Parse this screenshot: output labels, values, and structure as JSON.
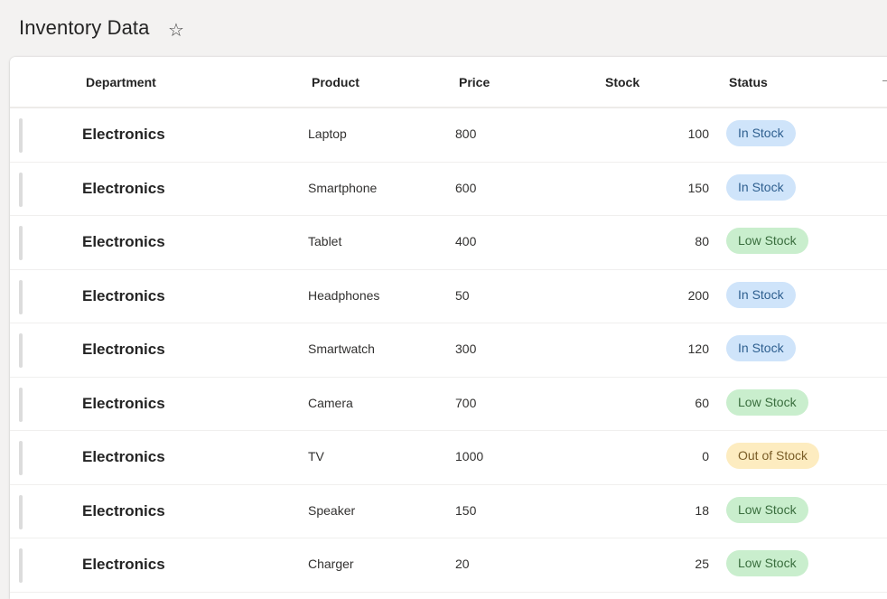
{
  "page": {
    "title": "Inventory Data",
    "star_icon": "star-outline-icon"
  },
  "table": {
    "columns": {
      "department": "Department",
      "product": "Product",
      "price": "Price",
      "stock": "Stock",
      "status": "Status"
    },
    "rows": [
      {
        "department": "Electronics",
        "product": "Laptop",
        "price": "800",
        "stock": "100",
        "status": "In Stock",
        "status_kind": "in"
      },
      {
        "department": "Electronics",
        "product": "Smartphone",
        "price": "600",
        "stock": "150",
        "status": "In Stock",
        "status_kind": "in"
      },
      {
        "department": "Electronics",
        "product": "Tablet",
        "price": "400",
        "stock": "80",
        "status": "Low Stock",
        "status_kind": "low"
      },
      {
        "department": "Electronics",
        "product": "Headphones",
        "price": "50",
        "stock": "200",
        "status": "In Stock",
        "status_kind": "in"
      },
      {
        "department": "Electronics",
        "product": "Smartwatch",
        "price": "300",
        "stock": "120",
        "status": "In Stock",
        "status_kind": "in"
      },
      {
        "department": "Electronics",
        "product": "Camera",
        "price": "700",
        "stock": "60",
        "status": "Low Stock",
        "status_kind": "low"
      },
      {
        "department": "Electronics",
        "product": "TV",
        "price": "1000",
        "stock": "0",
        "status": "Out of Stock",
        "status_kind": "out"
      },
      {
        "department": "Electronics",
        "product": "Speaker",
        "price": "150",
        "stock": "18",
        "status": "Low Stock",
        "status_kind": "low"
      },
      {
        "department": "Electronics",
        "product": "Charger",
        "price": "20",
        "stock": "25",
        "status": "Low Stock",
        "status_kind": "low"
      }
    ]
  },
  "colors": {
    "in_stock_bg": "#cfe4fa",
    "low_stock_bg": "#c9eecd",
    "out_of_stock_bg": "#fdecc0"
  }
}
